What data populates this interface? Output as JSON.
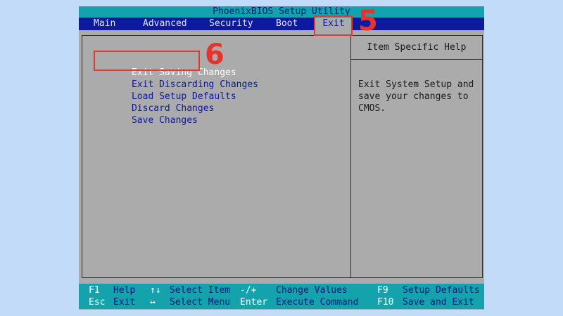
{
  "bios": {
    "title": "PhoenixBIOS Setup Utility",
    "menu": [
      {
        "label": "Main"
      },
      {
        "label": "Advanced"
      },
      {
        "label": "Security"
      },
      {
        "label": "Boot"
      },
      {
        "label": "Exit",
        "active": true
      }
    ],
    "options": [
      {
        "label": "Exit Saving Changes",
        "selected": true
      },
      {
        "label": "Exit Discarding Changes"
      },
      {
        "label": "Load Setup Defaults"
      },
      {
        "label": "Discard Changes"
      },
      {
        "label": "Save Changes"
      }
    ],
    "help": {
      "header": "Item Specific Help",
      "lines": [
        "Exit System Setup and",
        "save your changes to",
        "CMOS."
      ]
    },
    "status_bar": {
      "row1": [
        {
          "key": "F1",
          "desc": "Help"
        },
        {
          "key": "↑↓",
          "desc": "Select Item"
        },
        {
          "key": "-/+",
          "desc": "Change Values"
        },
        {
          "key": "F9",
          "desc": "Setup Defaults"
        }
      ],
      "row2": [
        {
          "key": "Esc",
          "desc": "Exit"
        },
        {
          "key": "↔",
          "desc": "Select Menu"
        },
        {
          "key": "Enter",
          "desc": "Execute Command"
        },
        {
          "key": "F10",
          "desc": "Save and Exit"
        }
      ]
    }
  },
  "annotations": {
    "step_exit_tab": "5",
    "step_exit_saving": "6",
    "color": "#e8322c"
  },
  "colors": {
    "background": "#c1dbf9",
    "screen": "#ababab",
    "title_bar": "#14a3ac",
    "menu_bar": "#0b1a9e",
    "option_text": "#0b1a9e",
    "selected_text": "#ffffff"
  }
}
